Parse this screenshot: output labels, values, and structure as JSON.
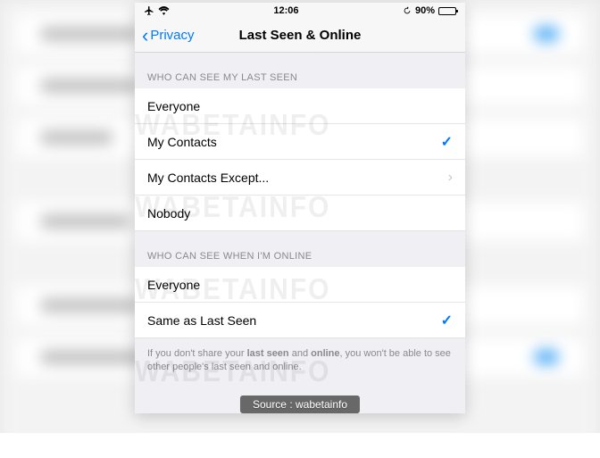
{
  "status_bar": {
    "time": "12:06",
    "battery_pct": "90%"
  },
  "nav": {
    "back_label": "Privacy",
    "title": "Last Seen & Online"
  },
  "section1": {
    "header": "WHO CAN SEE MY LAST SEEN",
    "options": {
      "everyone": "Everyone",
      "my_contacts": "My Contacts",
      "my_contacts_except": "My Contacts Except...",
      "nobody": "Nobody"
    }
  },
  "section2": {
    "header": "WHO CAN SEE WHEN I'M ONLINE",
    "options": {
      "everyone": "Everyone",
      "same_as": "Same as Last Seen"
    }
  },
  "note": {
    "prefix": "If you don't share your ",
    "b1": "last seen",
    "mid": " and ",
    "b2": "online",
    "suffix": ", you won't be able to see other people's last seen and online."
  },
  "watermark_text": "WABETAINFO",
  "source_credit": "Source : wabetainfo"
}
